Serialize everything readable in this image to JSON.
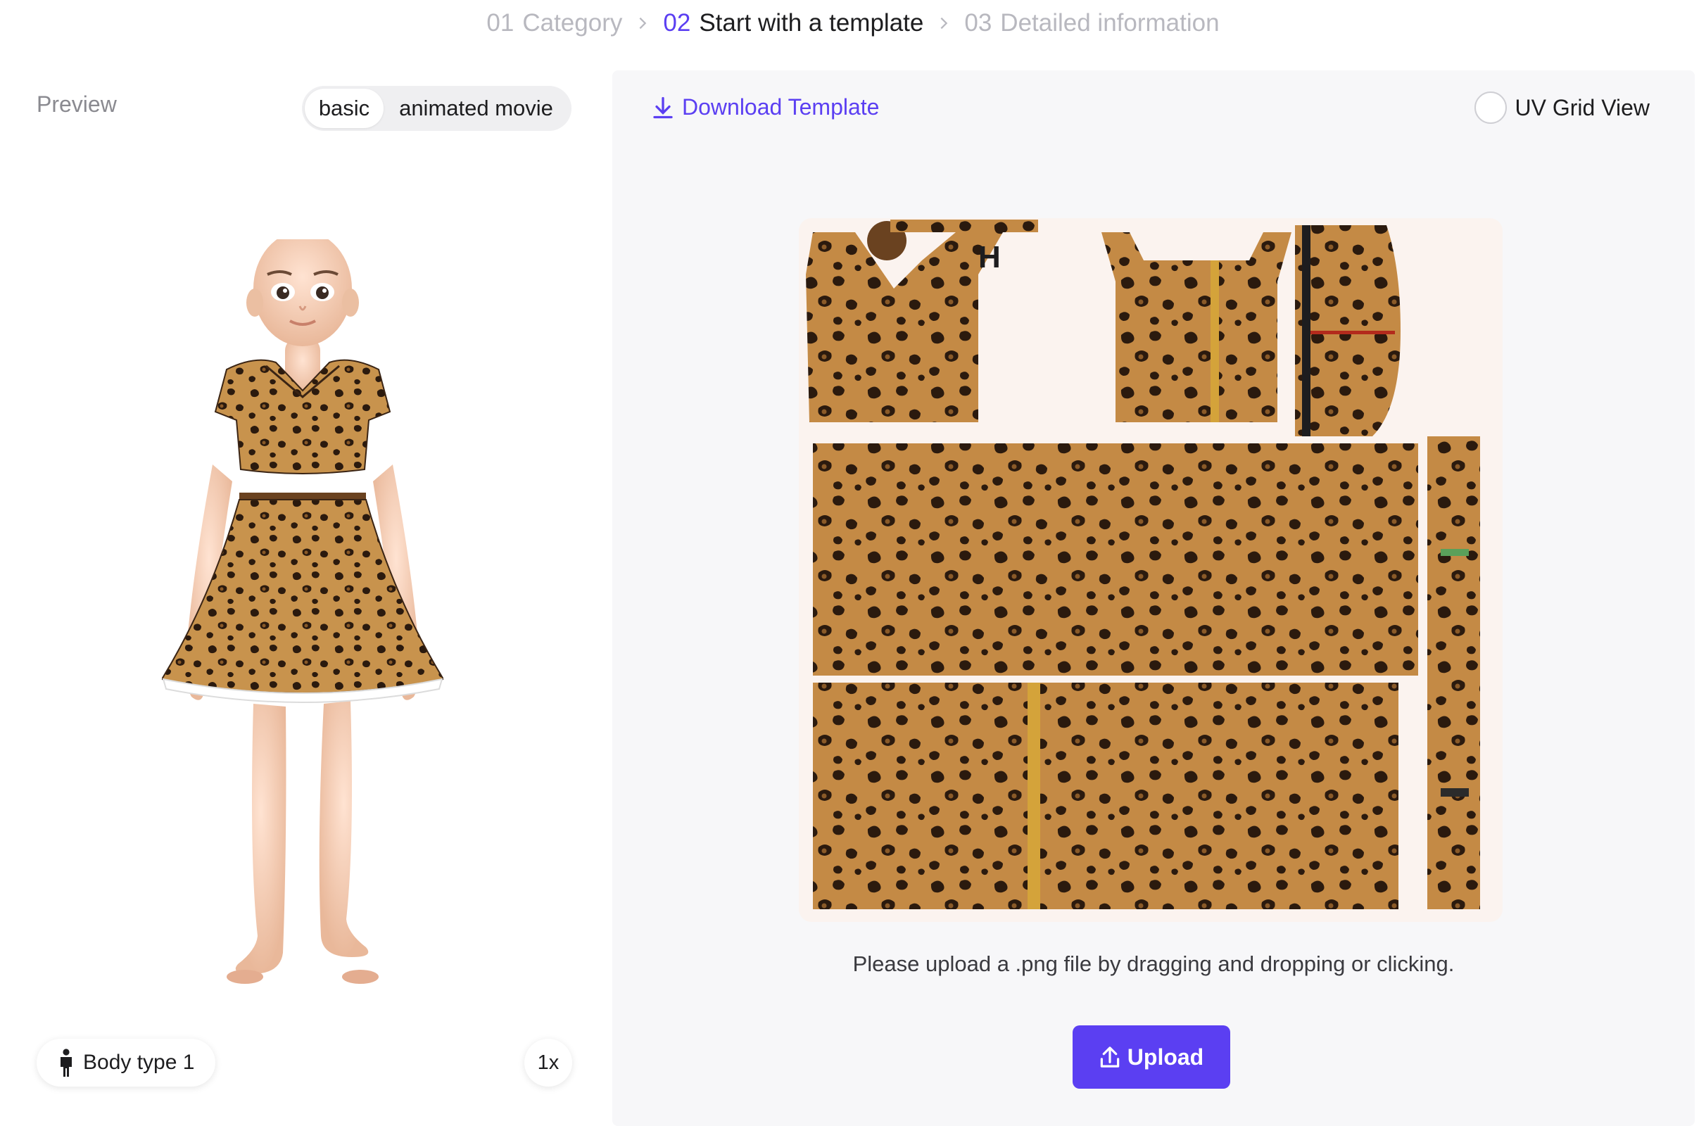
{
  "stepper": {
    "steps": [
      {
        "num": "01",
        "label": "Category"
      },
      {
        "num": "02",
        "label": "Start with a template"
      },
      {
        "num": "03",
        "label": "Detailed information"
      }
    ],
    "active_index": 1
  },
  "preview": {
    "label": "Preview",
    "style_options": [
      "basic",
      "animated movie"
    ],
    "selected_style": "basic",
    "body_type": "Body type 1",
    "zoom": "1x"
  },
  "template": {
    "download_label": "Download Template",
    "uv_grid_label": "UV Grid View",
    "uv_grid_enabled": false,
    "hint": "Please upload a .png file by dragging and dropping or clicking.",
    "upload_label": "Upload"
  },
  "colors": {
    "accent": "#5b3ff2",
    "panel_bg": "#f7f7f9",
    "leopard_base": "#c8934d",
    "leopard_spot": "#2b1a0e"
  }
}
